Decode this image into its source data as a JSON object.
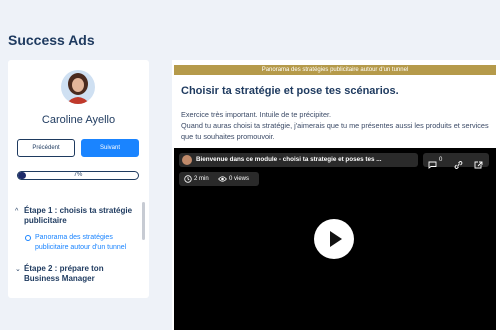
{
  "page": {
    "title": "Success Ads"
  },
  "sidebar": {
    "user_name": "Caroline Ayello",
    "prev_label": "Précédent",
    "next_label": "Suivant",
    "progress": {
      "percent": 7,
      "label": "7%"
    },
    "steps": [
      {
        "label": "Étape 1 : choisis ta stratégie publicitaire",
        "expanded": true,
        "substeps": [
          {
            "label": "Panorama des stratégies publicitaire autour d'un tunnel",
            "active": true
          }
        ]
      },
      {
        "label": "Étape 2 : prépare ton Business Manager",
        "expanded": false
      }
    ]
  },
  "main": {
    "banner": "Panorama des stratégies publicitaire autour d'un tunnel",
    "lesson_title": "Choisir ta stratégie et pose tes scénarios.",
    "desc_line1": "Exercice très important. Intuile de te précipiter.",
    "desc_line2": "Quand tu auras choisi ta stratégie, j'aimerais que tu me présentes aussi les produits et services que tu souhaites promouvoir.",
    "video": {
      "title": "Bienvenue dans ce module - choisi ta strategie et poses tes ...",
      "comments": "0",
      "duration": "2 min",
      "views": "0 views"
    }
  },
  "colors": {
    "accent": "#1a84ff",
    "navy": "#1e3a5f",
    "banner": "#b59a4a",
    "background": "#eef2f8"
  }
}
